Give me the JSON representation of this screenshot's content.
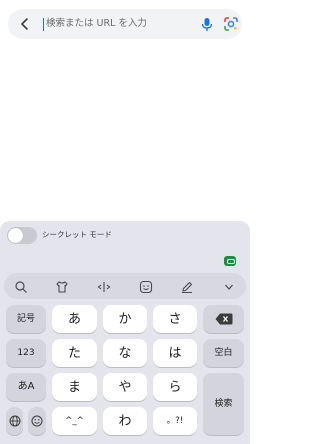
{
  "search": {
    "placeholder": "検索または URL を入力"
  },
  "incognito": {
    "label": "シークレット モード",
    "enabled": false
  },
  "toolbar": {
    "icons": [
      "search-icon",
      "clipboard-shirt-icon",
      "cursor-move-icon",
      "emoji-icon",
      "edit-pen-icon",
      "collapse-keyboard-icon"
    ]
  },
  "keyboard": {
    "row1": {
      "symbols": "記号",
      "a": "あ",
      "ka": "か",
      "sa": "さ"
    },
    "row2": {
      "num": "123",
      "ta": "た",
      "na": "な",
      "ha": "は",
      "space": "空白"
    },
    "row3": {
      "mode": "あA",
      "ma": "ま",
      "ya": "や",
      "ra": "ら"
    },
    "row4": {
      "kaomoji": "^_^",
      "wa": "わ",
      "punct": "。?!",
      "search": "検索"
    }
  },
  "colors": {
    "keyboard_bg": "#e4e5ec",
    "key_bg": "#ffffff",
    "function_key_bg": "#d3d4dc",
    "search_bar_bg": "#f1f3f4",
    "cursor": "#1a73e8",
    "ime_badge": "#1e8e3e"
  }
}
